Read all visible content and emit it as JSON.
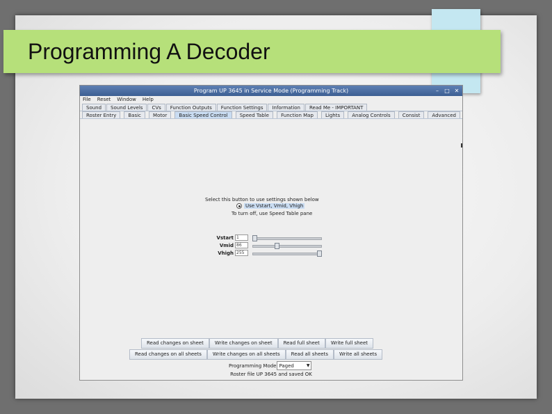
{
  "slide": {
    "title": "Programming A Decoder",
    "accent_green": "#b6e07a",
    "accent_cyan": "#c4e7f1"
  },
  "window": {
    "title": "Program UP 3645 in Service Mode (Programming Track)",
    "controls": [
      "–",
      "□",
      "✕"
    ],
    "menu": [
      "File",
      "Reset",
      "Window",
      "Help"
    ],
    "tabs_row1": [
      "Sound",
      "Sound Levels",
      "CVs",
      "Function Outputs",
      "Function Settings",
      "Information",
      "Read Me - IMPORTANT"
    ],
    "tabs_row2": [
      "Roster Entry",
      "Basic",
      "Motor",
      "Basic Speed Control",
      "Speed Table",
      "Function Map",
      "Lights",
      "Analog Controls",
      "Consist",
      "Advanced"
    ],
    "active_tab": "Basic Speed Control",
    "selection_color": "#c9dcf2"
  },
  "speed": {
    "select_label": "Select this button to use settings shown below",
    "radio_label": "Use Vstart, Vmid, Vhigh",
    "turn_off_label": "To turn off, use Speed Table pane",
    "rows": [
      {
        "label": "Vstart",
        "value": "1",
        "level": 0.0
      },
      {
        "label": "Vmid",
        "value": "86",
        "level": 0.34
      },
      {
        "label": "Vhigh",
        "value": "255",
        "level": 1.0
      }
    ]
  },
  "buttons_row1": [
    "Read changes on sheet",
    "Write changes on sheet",
    "Read full sheet",
    "Write full sheet"
  ],
  "buttons_row2": [
    "Read changes on all sheets",
    "Write changes on all sheets",
    "Read all sheets",
    "Write all sheets"
  ],
  "programming": {
    "mode_label": "Programming Mode",
    "mode_value": "Paged"
  },
  "status": "Roster file UP 3645 and saved OK"
}
